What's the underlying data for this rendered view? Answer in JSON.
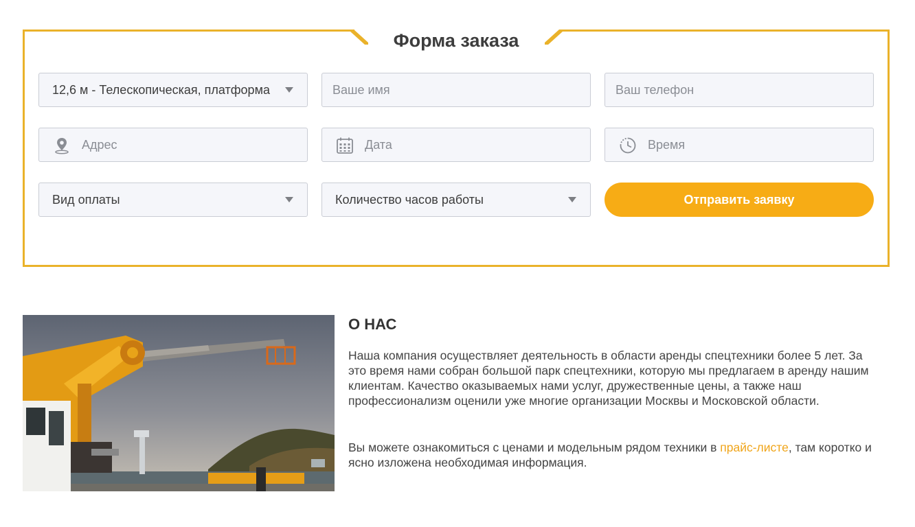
{
  "order_form": {
    "title": "Форма заказа",
    "equipment_select": "12,6 м - Телескопическая, платформа",
    "name_placeholder": "Ваше имя",
    "phone_placeholder": "Ваш телефон",
    "address_placeholder": "Адрес",
    "date_placeholder": "Дата",
    "time_placeholder": "Время",
    "payment_select": "Вид оплаты",
    "hours_select": "Количество часов работы",
    "submit_label": "Отправить заявку"
  },
  "about": {
    "title": "О НАС",
    "paragraph1": "Наша компания осуществляет деятельность в области аренды спецтехники более 5 лет. За это время нами собран большой парк спецтехники, которую мы предлагаем в аренду нашим клиентам. Качество оказываемых нами услуг, дружественные цены, а также наш профессионализм оценили уже многие организации Москвы и Московской области.",
    "paragraph2_before": "Вы можете ознакомиться с ценами и модельным рядом техники в ",
    "price_link": "прайс-листе",
    "paragraph2_after": ", там коротко и ясно изложена необходимая информация."
  },
  "colors": {
    "accent": "#eab22a",
    "button": "#f7ac15",
    "link": "#f0a51a"
  },
  "icons": [
    "chevron-down-icon",
    "location-pin-icon",
    "calendar-icon",
    "clock-icon"
  ]
}
